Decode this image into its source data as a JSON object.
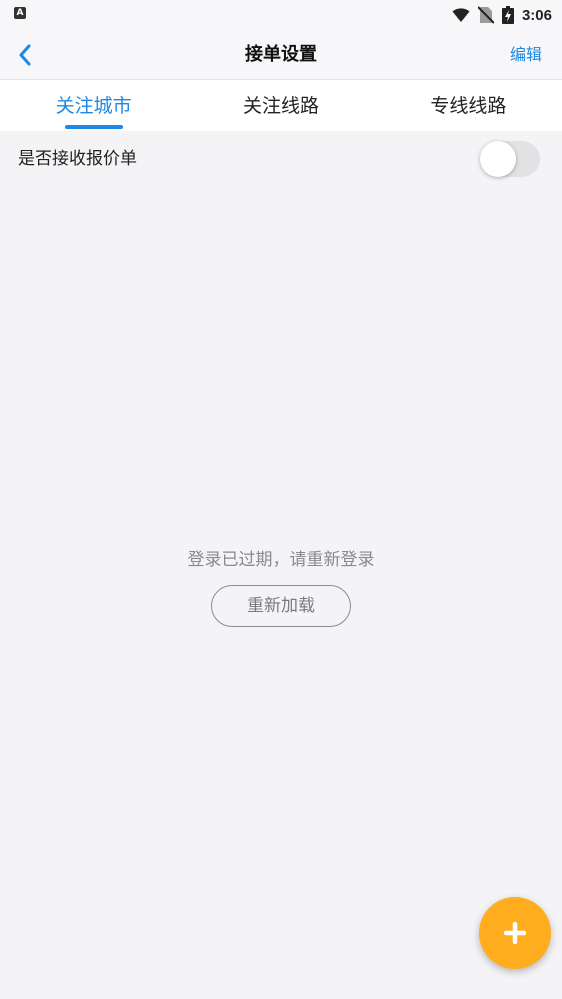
{
  "status_bar": {
    "time": "3:06",
    "app_icon_letter": "A",
    "icons": [
      "wifi-icon",
      "no-sim-icon",
      "battery-charging-icon"
    ]
  },
  "nav": {
    "title": "接单设置",
    "action": "编辑",
    "back_icon": "chevron-left-icon"
  },
  "tabs": [
    {
      "label": "关注城市",
      "active": true
    },
    {
      "label": "关注线路",
      "active": false
    },
    {
      "label": "专线线路",
      "active": false
    }
  ],
  "toggle_row": {
    "label": "是否接收报价单",
    "enabled": false
  },
  "empty_state": {
    "message": "登录已过期，请重新登录",
    "reload_label": "重新加载"
  },
  "fab": {
    "icon": "plus-icon"
  },
  "colors": {
    "accent": "#1e88e5",
    "fab": "#ffad1f",
    "background": "#f4f4f6"
  }
}
